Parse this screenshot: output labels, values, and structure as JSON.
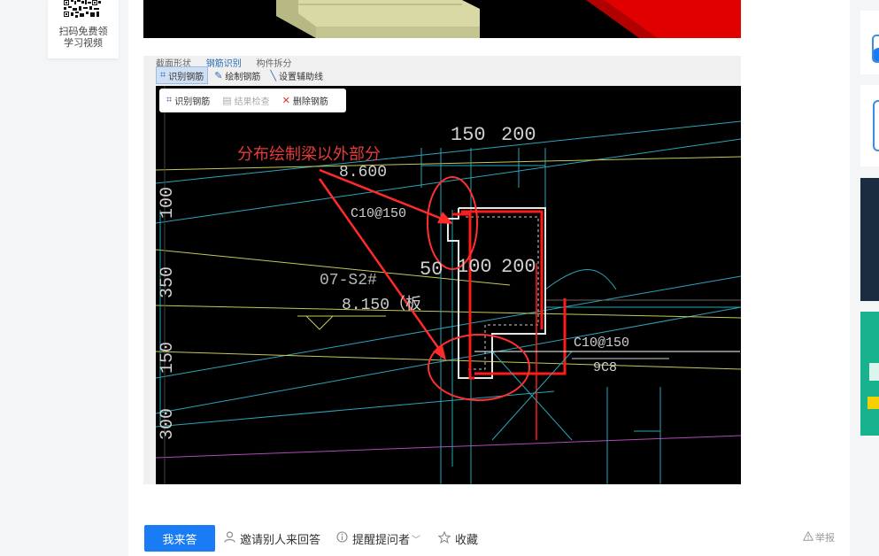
{
  "qr_card": {
    "caption_line1": "扫码免费领",
    "caption_line2": "学习视频"
  },
  "cad": {
    "tabs": [
      "截面形状",
      "钢筋识别",
      "构件拆分"
    ],
    "toolbar": [
      "识别钢筋",
      "绘制钢筋",
      "设置辅助线"
    ],
    "float_toolbar": [
      "识别钢筋",
      "结果检查",
      "删除钢筋"
    ],
    "annotation": "分布绘制梁以外部分",
    "dimensions": {
      "d150": "150",
      "d200": "200",
      "elev1": "8.600",
      "rebar1": "C10@150",
      "d100": "100",
      "d350": "350",
      "label_mirror": "07-S2#",
      "elev2": "8.150（板",
      "d50": "50",
      "d100b": "100",
      "d200b": "200",
      "d150b": "150",
      "d300": "300",
      "rebar2": "C10@150",
      "rebar3": "9C8"
    }
  },
  "actions": {
    "answer": "我来答",
    "invite": "邀请别人来回答",
    "remind": "提醒提问者",
    "collect": "收藏",
    "report": "举报"
  },
  "colors": {
    "primary": "#1a7cf5",
    "annotation_red": "#e83a3a",
    "rebar_red": "#ff1a1a"
  },
  "icons": {
    "invite": "person-icon",
    "remind": "info-circle-icon",
    "collect": "star-icon",
    "report": "warning-icon"
  }
}
